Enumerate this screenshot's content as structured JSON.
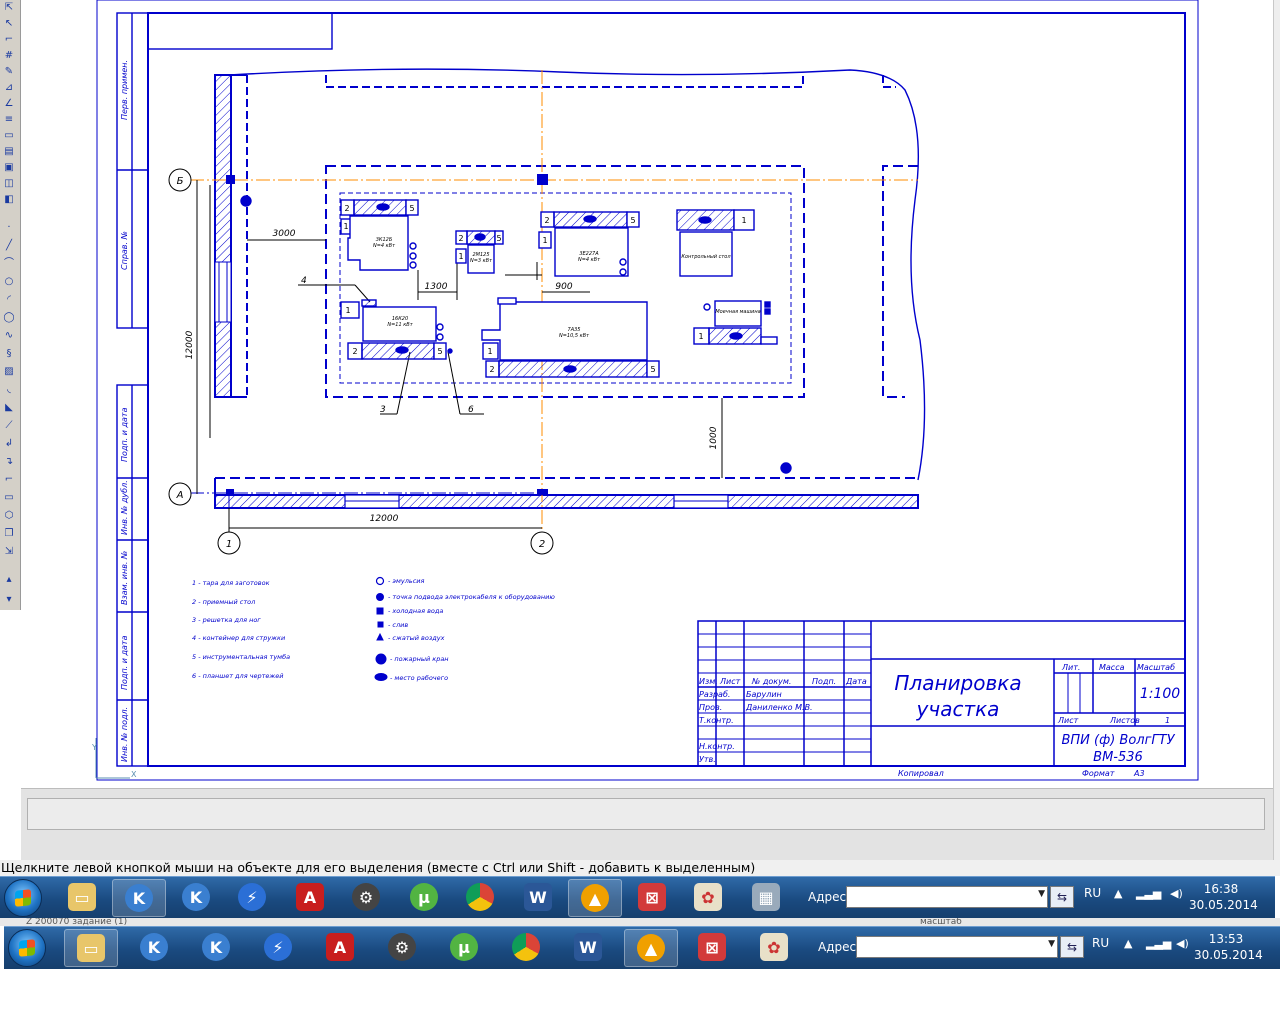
{
  "drawing": {
    "marks": {
      "axis_b": "Б",
      "axis_a": "А",
      "axis_1": "1",
      "axis_2": "2"
    },
    "dims": {
      "d3000": "3000",
      "d1300": "1300",
      "d900": "900",
      "d12000v": "12000",
      "d12000h": "12000",
      "d1000": "1000"
    },
    "leaders": {
      "l4": "4",
      "l3": "3",
      "l6": "6"
    },
    "machines": {
      "m1": {
        "model": "3К12Б",
        "power": "N=4 кВт"
      },
      "m2": {
        "model": "2М125",
        "power": "N=3 кВт"
      },
      "m3": {
        "model": "3Е227А",
        "power": "N=4 кВт"
      },
      "m4": {
        "model": "Контрольный стол"
      },
      "m5": {
        "model": "16К20",
        "power": "N=11 кВт"
      },
      "m6": {
        "model": "7А35",
        "power": "N=10,5 кВт"
      },
      "m7": {
        "model": "Моечная машина"
      }
    },
    "legend_left": [
      "1 - тара для заготовок",
      "2 - приемный стол",
      "3 - решетка для ног",
      "4 - контейнер для стружки",
      "5 - инструментальная тумба",
      "6 - планшет для чертежей"
    ],
    "legend_right": [
      "- эмульсия",
      "- точка подвода электрокабеля к оборудованию",
      "- холодная вода",
      "- слив",
      "- сжатый воздух",
      "- пожарный кран",
      "- место рабочего"
    ],
    "side_stamps": [
      "Перв. примен.",
      "Справ. №",
      "Подп. и дата",
      "Инв. № дубл.",
      "Взам. инв. №",
      "Подп. и дата",
      "Инв. № подл."
    ],
    "title_block": {
      "title_line1": "Планировка",
      "title_line2": "участка",
      "h_izm": "Изм.",
      "h_list": "Лист",
      "h_ndoc": "№ докум.",
      "h_podp": "Подп.",
      "h_data": "Дата",
      "r_razrab": "Разраб.",
      "r_prov": "Пров.",
      "r_tkontr": "Т.контр.",
      "r_nkontr": "Н.контр.",
      "r_utv": "Утв.",
      "razrab_name": "Барулин",
      "prov_name": "Даниленко М.В.",
      "lit": "Лит.",
      "massa": "Масса",
      "masshtab": "Масштаб",
      "scale": "1:100",
      "list": "Лист",
      "listov": "Листов",
      "listov_val": "1",
      "org_line1": "ВПИ (ф) ВолгГТУ",
      "org_line2": "ВМ-536",
      "kopiroval": "Копировал",
      "format": "Формат",
      "format_val": "А3"
    },
    "origin": {
      "y": "Y",
      "x": "X"
    }
  },
  "status_hint": "Щелкните левой кнопкой мыши на объекте для его выделения (вместе с Ctrl или Shift - добавить к выделенным)",
  "taskbar_top": {
    "address_label": "Адрес",
    "address_value": "",
    "lang": "RU",
    "time": "16:38",
    "date": "30.05.2014"
  },
  "taskbar_bottom": {
    "address_label": "Адрес",
    "address_value": "",
    "lang": "RU",
    "time": "13:53",
    "date": "30.05.2014"
  },
  "gap_text": {
    "left": "Z 200070 задание (1)",
    "right": "масштаб"
  },
  "colors": {
    "drawing_blue": "#0000cc",
    "axis_orange": "#ff8c00",
    "taskbar": "#1f5590"
  }
}
